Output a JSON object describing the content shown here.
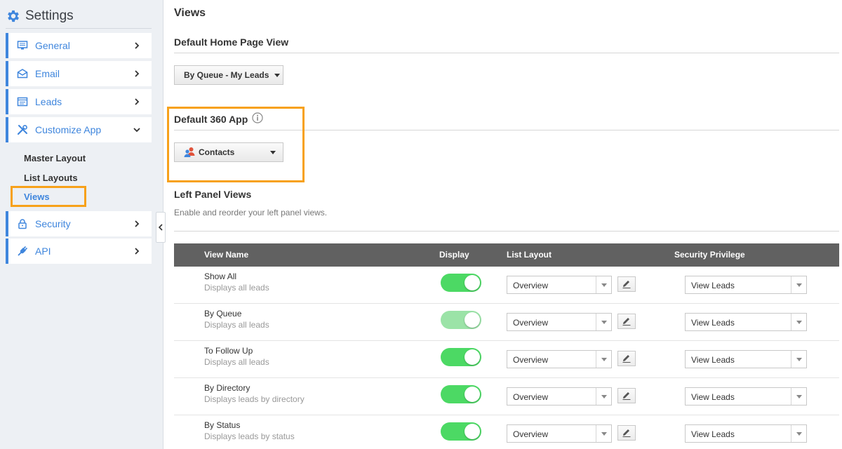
{
  "sidebar": {
    "title": "Settings",
    "items": [
      {
        "label": "General",
        "icon": "monitor-icon"
      },
      {
        "label": "Email",
        "icon": "envelope-icon"
      },
      {
        "label": "Leads",
        "icon": "list-card-icon"
      },
      {
        "label": "Customize App",
        "icon": "tools-icon"
      },
      {
        "label": "Security",
        "icon": "lock-icon"
      },
      {
        "label": "API",
        "icon": "plug-icon"
      }
    ],
    "subitems": [
      "Master Layout",
      "List Layouts",
      "Views"
    ]
  },
  "main": {
    "page_title": "Views",
    "home_view": {
      "title": "Default Home Page View",
      "value": "By Queue - My Leads"
    },
    "app360": {
      "title": "Default 360 App",
      "value": "Contacts"
    },
    "left_panel": {
      "title": "Left Panel Views",
      "subtitle": "Enable and reorder your left panel views."
    },
    "table": {
      "headers": [
        "View Name",
        "Display",
        "List Layout",
        "Security Privilege"
      ],
      "rows": [
        {
          "name": "Show All",
          "desc": "Displays all leads",
          "layout": "Overview",
          "privilege": "View Leads",
          "display_on": true
        },
        {
          "name": "By Queue",
          "desc": "Displays all leads",
          "layout": "Overview",
          "privilege": "View Leads",
          "display_on": true
        },
        {
          "name": "To Follow Up",
          "desc": "Displays all leads",
          "layout": "Overview",
          "privilege": "View Leads",
          "display_on": true
        },
        {
          "name": "By Directory",
          "desc": "Displays leads by directory",
          "layout": "Overview",
          "privilege": "View Leads",
          "display_on": true
        },
        {
          "name": "By Status",
          "desc": "Displays leads by status",
          "layout": "Overview",
          "privilege": "View Leads",
          "display_on": true
        }
      ]
    }
  },
  "colors": {
    "accent": "#3f86dd",
    "highlight": "#f7a11a",
    "toggle_on": "#4cd964",
    "table_header": "#616161"
  }
}
